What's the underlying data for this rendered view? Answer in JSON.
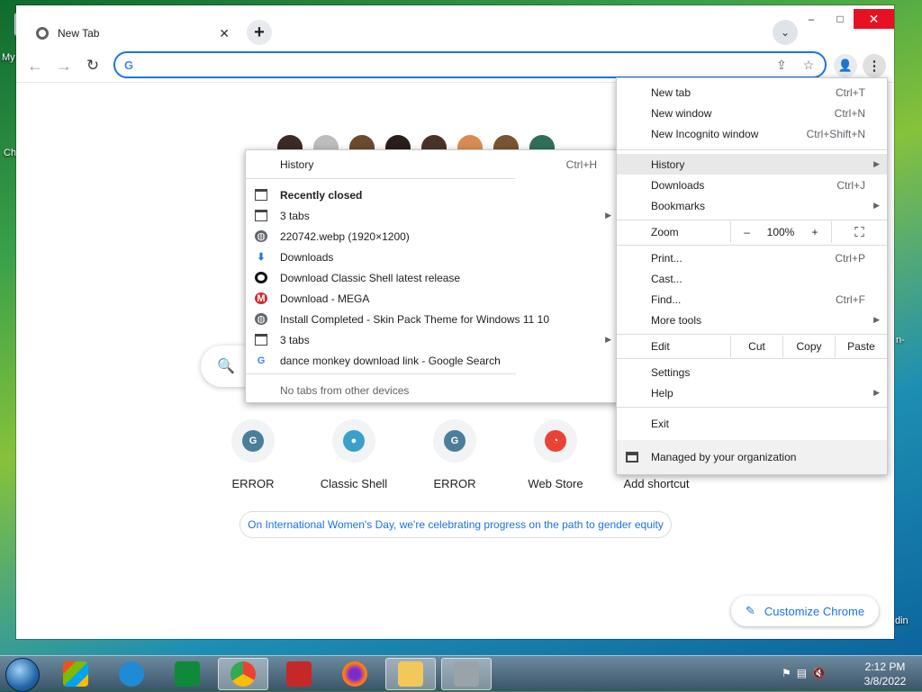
{
  "desktop": {
    "labels": [
      "My",
      "Ch"
    ],
    "right_labels": [
      "n-",
      "din"
    ]
  },
  "browser": {
    "tab_title": "New Tab",
    "tab_close": "✕",
    "new_tab_symbol": "+",
    "tab_search_symbol": "⌄",
    "window_controls": {
      "minimize": "–",
      "maximize": "□",
      "close": "✕"
    },
    "nav": {
      "back": "←",
      "forward": "→",
      "reload": "↻"
    },
    "omnibox": {
      "google_glyph": "G",
      "value": "",
      "share_icon": "⇪",
      "star_icon": "☆"
    },
    "profile_icon": "👤",
    "menu_icon": "⋮"
  },
  "ntp": {
    "search_icon": "🔍",
    "shortcuts": [
      {
        "label": "ERROR",
        "glyph": "G",
        "color": "#4b7f99"
      },
      {
        "label": "Classic Shell",
        "glyph": "●",
        "color": "#3aa0c9"
      },
      {
        "label": "ERROR",
        "glyph": "G",
        "color": "#4b7f99"
      },
      {
        "label": "Web Store",
        "glyph": "◔",
        "color": "#ea4335"
      },
      {
        "label": "Add shortcut",
        "glyph": "",
        "color": "#ffffff"
      }
    ],
    "promo": "On International Women's Day, we're celebrating progress on the path to gender equity",
    "customize": {
      "label": "Customize Chrome",
      "icon": "✎"
    }
  },
  "menu": {
    "new_tab": {
      "label": "New tab",
      "shortcut": "Ctrl+T"
    },
    "new_window": {
      "label": "New window",
      "shortcut": "Ctrl+N"
    },
    "incognito": {
      "label": "New Incognito window",
      "shortcut": "Ctrl+Shift+N"
    },
    "history": {
      "label": "History",
      "arrow": "▶"
    },
    "downloads": {
      "label": "Downloads",
      "shortcut": "Ctrl+J"
    },
    "bookmarks": {
      "label": "Bookmarks",
      "arrow": "▶"
    },
    "zoom": {
      "label": "Zoom",
      "minus": "–",
      "value": "100%",
      "plus": "+",
      "fullscreen": "⛶"
    },
    "print": {
      "label": "Print...",
      "shortcut": "Ctrl+P"
    },
    "cast": {
      "label": "Cast..."
    },
    "find": {
      "label": "Find...",
      "shortcut": "Ctrl+F"
    },
    "more_tools": {
      "label": "More tools",
      "arrow": "▶"
    },
    "edit": {
      "label": "Edit",
      "cut": "Cut",
      "copy": "Copy",
      "paste": "Paste"
    },
    "settings": {
      "label": "Settings"
    },
    "help": {
      "label": "Help",
      "arrow": "▶"
    },
    "exit": {
      "label": "Exit"
    },
    "managed": {
      "label": "Managed by your organization"
    }
  },
  "history_menu": {
    "history": {
      "label": "History",
      "shortcut": "Ctrl+H"
    },
    "recently_closed": "Recently closed",
    "items": [
      {
        "label": "3 tabs",
        "icon": "tabs",
        "arrow": "▶"
      },
      {
        "label": "220742.webp (1920×1200)",
        "icon": "globe"
      },
      {
        "label": "Downloads",
        "icon": "download"
      },
      {
        "label": "Download Classic Shell latest release",
        "icon": "ring"
      },
      {
        "label": "Download - MEGA",
        "icon": "mega"
      },
      {
        "label": "Install Completed - Skin Pack Theme for Windows 11  10",
        "icon": "globe"
      },
      {
        "label": "3 tabs",
        "icon": "tabs",
        "arrow": "▶"
      },
      {
        "label": "dance monkey download link - Google Search",
        "icon": "google"
      }
    ],
    "no_tabs": "No tabs from other devices",
    "glyphs": {
      "globe": "◍",
      "download": "⬇",
      "mega": "M",
      "google": "G"
    }
  },
  "taskbar": {
    "clock_time": "2:12 PM",
    "clock_date": "3/8/2022",
    "tray_icons": [
      "⚑",
      "▤",
      "🔇"
    ]
  }
}
